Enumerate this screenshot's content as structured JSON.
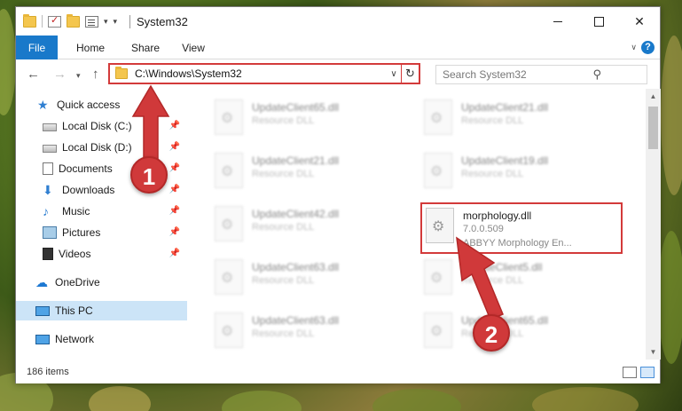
{
  "window": {
    "title": "System32",
    "tabs": [
      "File",
      "Home",
      "Share",
      "View"
    ]
  },
  "address": {
    "path": "C:\\Windows\\System32",
    "search_placeholder": "Search System32"
  },
  "nav": {
    "quick_access": "Quick access",
    "items": [
      {
        "label": "Local Disk (C:)",
        "icon": "disk-icon",
        "pinned": true
      },
      {
        "label": "Local Disk (D:)",
        "icon": "disk-icon",
        "pinned": true
      },
      {
        "label": "Documents",
        "icon": "documents-icon",
        "pinned": true
      },
      {
        "label": "Downloads",
        "icon": "downloads-icon",
        "pinned": true
      },
      {
        "label": "Music",
        "icon": "music-icon",
        "pinned": true
      },
      {
        "label": "Pictures",
        "icon": "pictures-icon",
        "pinned": true
      },
      {
        "label": "Videos",
        "icon": "videos-icon",
        "pinned": true
      }
    ],
    "onedrive": "OneDrive",
    "this_pc": "This PC",
    "network": "Network"
  },
  "files": [
    {
      "name": "UpdateClient65.dll",
      "desc": "Resource DLL"
    },
    {
      "name": "UpdateClient21.dll",
      "desc": "Resource DLL"
    },
    {
      "name": "UpdateClient21.dll",
      "desc": "Resource DLL"
    },
    {
      "name": "UpdateClient19.dll",
      "desc": "Resource DLL"
    },
    {
      "name": "UpdateClient42.dll",
      "desc": "Resource DLL"
    },
    {
      "name": "morphology.dll",
      "desc": "7.0.0.509",
      "desc2": "ABBYY Morphology En..."
    },
    {
      "name": "UpdateClient63.dll",
      "desc": "Resource DLL"
    },
    {
      "name": "UpdateClient5.dll",
      "desc": "Resource DLL"
    },
    {
      "name": "UpdateClient63.dll",
      "desc": "Resource DLL"
    },
    {
      "name": "UpdateClient65.dll",
      "desc": "Resource DLL"
    }
  ],
  "status": {
    "count": "186 items"
  },
  "callouts": [
    "1",
    "2"
  ],
  "colors": {
    "accent": "#1979ca",
    "highlight": "#d33a3a",
    "selected": "#cce4f7"
  }
}
